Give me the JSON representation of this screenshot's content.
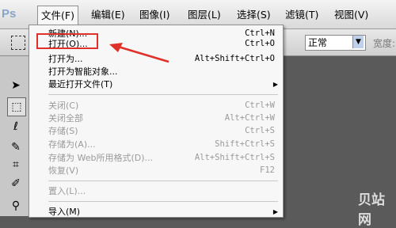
{
  "app": {
    "logo": "Ps"
  },
  "menubar": {
    "items": [
      {
        "label": "文件(F)"
      },
      {
        "label": "编辑(E)"
      },
      {
        "label": "图像(I)"
      },
      {
        "label": "图层(L)"
      },
      {
        "label": "选择(S)"
      },
      {
        "label": "滤镜(T)"
      },
      {
        "label": "视图(V)"
      }
    ]
  },
  "options": {
    "mode_select": "正常",
    "width_label": "宽度:"
  },
  "file_menu": {
    "items": [
      {
        "label": "新建(N)...",
        "shortcut": "Ctrl+N"
      },
      {
        "label": "打开(O)...",
        "shortcut": "Ctrl+O"
      },
      {
        "label": "打开为...",
        "shortcut": "Alt+Shift+Ctrl+O"
      },
      {
        "label": "打开为智能对象..."
      },
      {
        "label": "最近打开文件(T)"
      },
      {
        "label": "关闭(C)",
        "shortcut": "Ctrl+W"
      },
      {
        "label": "关闭全部",
        "shortcut": "Alt+Ctrl+W"
      },
      {
        "label": "存储(S)",
        "shortcut": "Ctrl+S"
      },
      {
        "label": "存储为(A)...",
        "shortcut": "Shift+Ctrl+S"
      },
      {
        "label": "存储为 Web所用格式(D)...",
        "shortcut": "Alt+Shift+Ctrl+S"
      },
      {
        "label": "恢复(V)",
        "shortcut": "F12"
      },
      {
        "label": "置入(L)..."
      },
      {
        "label": "导入(M)"
      }
    ]
  },
  "watermark": "贝站网",
  "colors": {
    "highlight": "#e0302a",
    "menu_bg": "#f7f7f7",
    "workspace": "#5a5a5a"
  }
}
